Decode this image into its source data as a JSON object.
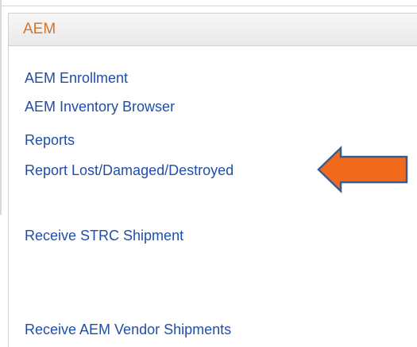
{
  "section": {
    "title": "AEM"
  },
  "menu": {
    "items": [
      {
        "label": "AEM Enrollment"
      },
      {
        "label": "AEM Inventory Browser"
      },
      {
        "label": "Reports"
      },
      {
        "label": "Report Lost/Damaged/Destroyed"
      },
      {
        "label": "Receive STRC Shipment"
      },
      {
        "label": "Receive AEM Vendor Shipments"
      }
    ]
  },
  "annotation": {
    "arrow_icon": "left-arrow-icon",
    "arrow_fill": "#f26b1d",
    "arrow_stroke": "#3b5c8f"
  },
  "colors": {
    "header_text": "#d8732b",
    "link_text": "#1f4ea8"
  }
}
